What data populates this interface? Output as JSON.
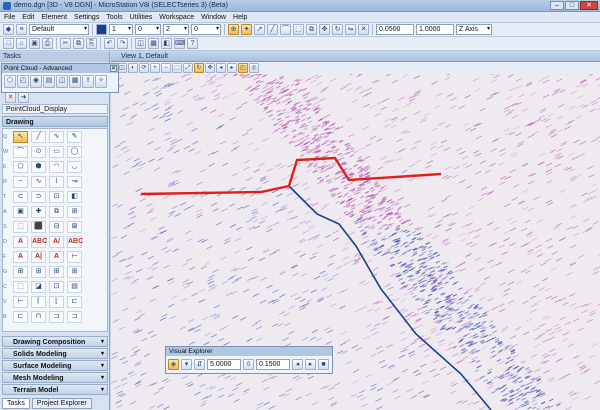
{
  "window": {
    "title": "demo.dgn [3D - V8 DGN] - MicroStation V8i (SELECTseries 3) (Beta)",
    "buttons": [
      "–",
      "□",
      "✕"
    ]
  },
  "menu": [
    "File",
    "Edit",
    "Element",
    "Settings",
    "Tools",
    "Utilities",
    "Workspace",
    "Window",
    "Help"
  ],
  "attributes": {
    "level": "Default",
    "color": "1",
    "style": "0",
    "weight": "2",
    "transparency": "0",
    "priority_a": "0.0500",
    "priority_b": "1.0000",
    "axis": "Z Axis"
  },
  "tasks": {
    "title": "Tasks",
    "pointcloud_panel": "Point Cloud - Advanced",
    "pointcloud_display": "PointCloud_Display",
    "drawing_header": "Drawing",
    "row_letters": [
      "Q",
      "W",
      "E",
      "R",
      "T",
      "A",
      "S",
      "D",
      "F",
      "G",
      "C",
      "V",
      "B"
    ],
    "drawing_tools": [
      "↖",
      "╱",
      "∿",
      "✎",
      "⌒",
      "⊙",
      "▭",
      "◯",
      "⬠",
      "⬢",
      "◠",
      "◡",
      "~",
      "∿",
      "⌇",
      "↝",
      "⊂",
      "⊃",
      "⊡",
      "◧",
      "▣",
      "✚",
      "⧉",
      "⊞",
      "⬚",
      "⬛",
      "⊟",
      "⊠",
      "A",
      "ABC",
      "A/",
      "ABC",
      "A",
      "A|",
      "A",
      "⊢",
      "⊞",
      "⊞",
      "⊞",
      "⊞",
      "⬚",
      "◪",
      "⊡",
      "▤",
      "⊢",
      "⌈",
      "⌊",
      "⊏",
      "⊏",
      "⊓",
      "⊐",
      "⊐"
    ],
    "sections": [
      "Drawing Composition",
      "Solids Modeling",
      "Surface Modeling",
      "Mesh Modeling",
      "Terrain Model"
    ],
    "bottom_tabs": [
      "Tasks",
      "Project Explorer"
    ]
  },
  "view": {
    "title": "View 1, Default"
  },
  "visual_explorer": {
    "title": "Visual Explorer",
    "value1": "5.0000",
    "value2": "0.1500"
  },
  "colors": {
    "cross_section": "#e0201b",
    "centerline": "#1a3f8a",
    "cloud_low": "#3f4fb0",
    "cloud_high": "#b14aa8"
  }
}
